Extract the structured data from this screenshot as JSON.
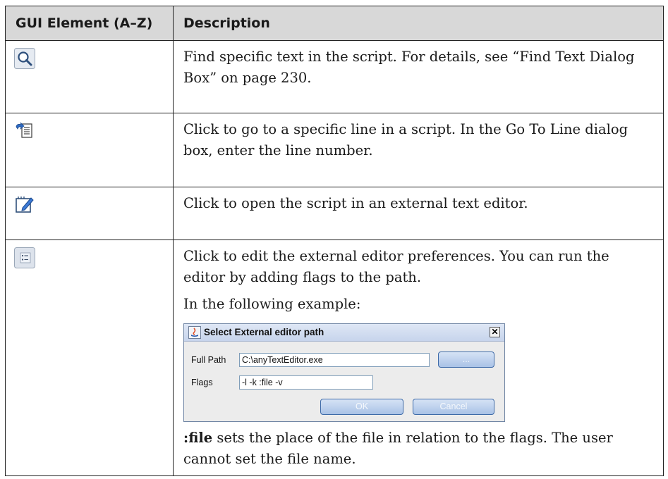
{
  "table": {
    "headers": [
      "GUI Element (A–Z)",
      "Description"
    ],
    "rows": [
      {
        "icon": "find-text-icon",
        "description": "Find specific text in the script. For details, see “Find Text Dialog Box” on page 230."
      },
      {
        "icon": "go-to-line-icon",
        "description": "Click to go to a specific line in a script. In the Go To Line dialog box, enter the line number."
      },
      {
        "icon": "external-editor-icon",
        "description": "Click to open the script in an external text editor."
      },
      {
        "icon": "editor-preferences-icon",
        "description": "Click to edit the external editor preferences. You can run the editor by adding flags to the path.",
        "example_intro": "In the following example:",
        "note_bold": ":file",
        "note_rest": " sets the place of the file in relation to the flags. The user cannot set the file name."
      }
    ]
  },
  "dialog": {
    "title": "Select External editor path",
    "close_label": "✕",
    "full_path_label": "Full Path",
    "full_path_value": "C:\\anyTextEditor.exe",
    "browse_label": "...",
    "flags_label": "Flags",
    "flags_value": "-l -k :file -v",
    "ok_label": "OK",
    "cancel_label": "Cancel"
  }
}
